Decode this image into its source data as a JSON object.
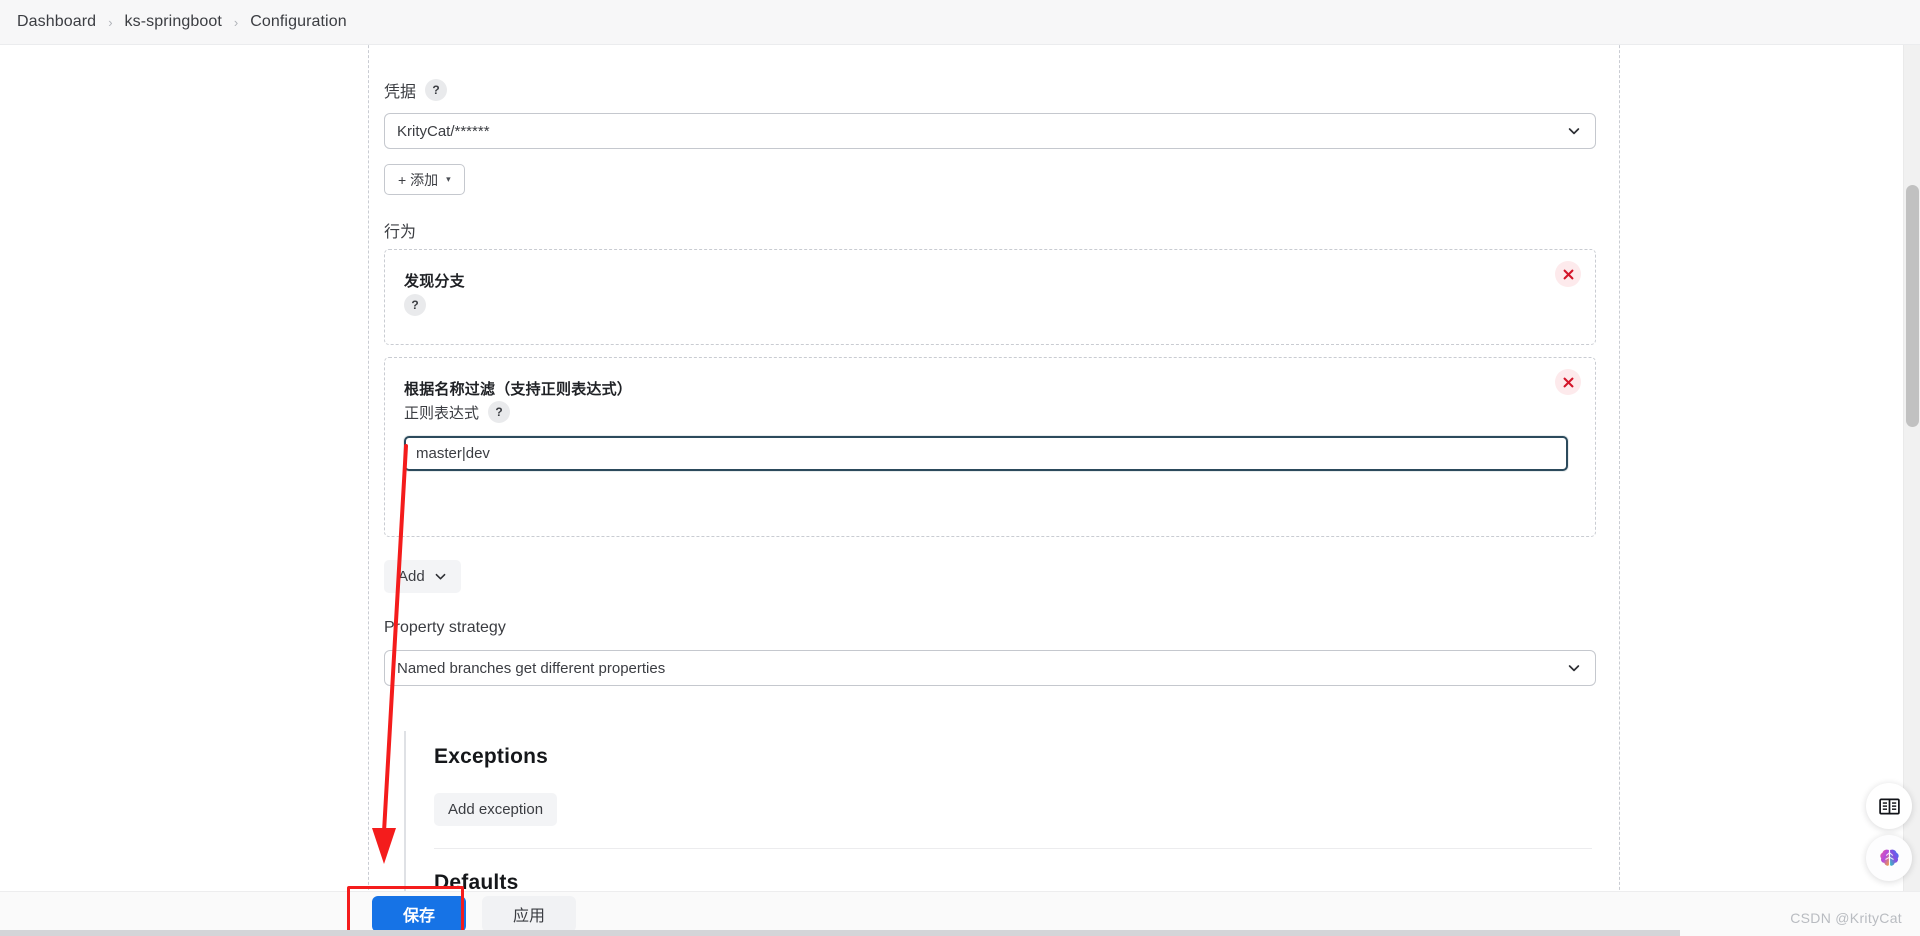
{
  "breadcrumb": {
    "items": [
      {
        "label": "Dashboard"
      },
      {
        "label": "ks-springboot"
      },
      {
        "label": "Configuration"
      }
    ],
    "separator": "›"
  },
  "form": {
    "credentials": {
      "label": "凭据",
      "help": "?",
      "value": "KrityCat/******",
      "add_button": "+ 添加",
      "add_caret": "▾"
    },
    "behaviors": {
      "label": "行为",
      "blocks": [
        {
          "title": "发现分支",
          "help": "?",
          "remove": "×"
        },
        {
          "title": "根据名称过滤（支持正则表达式）",
          "field_label": "正则表达式",
          "help": "?",
          "input_value": "master|dev",
          "input_placeholder": "",
          "remove": "×"
        }
      ],
      "add_button": "Add"
    },
    "property_strategy": {
      "label": "Property strategy",
      "value": "Named branches get different properties"
    }
  },
  "exceptions": {
    "heading": "Exceptions",
    "add_button": "Add exception"
  },
  "defaults": {
    "heading": "Defaults"
  },
  "footer": {
    "save_label": "保存",
    "apply_label": "应用"
  },
  "fabs": [
    {
      "name": "documentation",
      "icon": "book-icon"
    },
    {
      "name": "assistant",
      "icon": "brain-icon"
    }
  ],
  "watermark": "CSDN @KrityCat",
  "colors": {
    "primary": "#1673e6",
    "annotation": "#f41c1c",
    "focus_border": "#2c4a5c",
    "remove_bg": "#fdeaec",
    "remove_fg": "#d3152a"
  }
}
